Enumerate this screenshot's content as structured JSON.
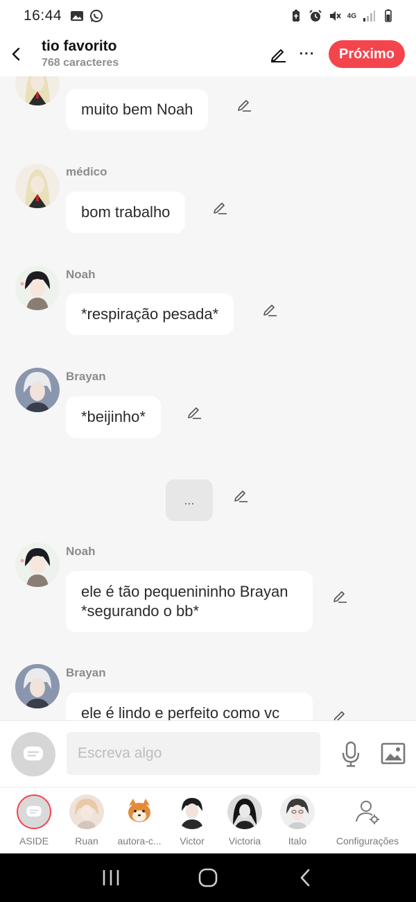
{
  "status_bar": {
    "time": "16:44",
    "network": "4G"
  },
  "header": {
    "title": "tio favorito",
    "subtitle": "768 caracteres",
    "next_label": "Próximo",
    "more_label": "···"
  },
  "messages": [
    {
      "sender": "",
      "text": "muito bem Noah",
      "avatar": "medico-avatar"
    },
    {
      "sender": "médico",
      "text": "bom trabalho",
      "avatar": "medico-avatar"
    },
    {
      "sender": "Noah",
      "text": "*respiração pesada*",
      "avatar": "noah-avatar"
    },
    {
      "sender": "Brayan",
      "text": "*beijinho*",
      "avatar": "brayan-avatar"
    },
    {
      "typing": "..."
    },
    {
      "sender": "Noah",
      "text": "ele é tão pequenininho Brayan *segurando o bb*",
      "avatar": "noah-avatar"
    },
    {
      "sender": "Brayan",
      "text": "ele é lindo e perfeito como vc",
      "avatar": "brayan-avatar"
    }
  ],
  "input": {
    "placeholder": "Escreva algo"
  },
  "characters": [
    {
      "label": "ASIDE",
      "icon": "aside-icon"
    },
    {
      "label": "Ruan",
      "icon": "ruan-avatar"
    },
    {
      "label": "autora-c...",
      "icon": "shiba-avatar"
    },
    {
      "label": "Victor",
      "icon": "victor-avatar"
    },
    {
      "label": "Victoria",
      "icon": "victoria-avatar"
    },
    {
      "label": "Italo",
      "icon": "italo-avatar"
    },
    {
      "label": "Configurações",
      "icon": "settings-user-icon"
    }
  ],
  "colors": {
    "accent": "#f4454d",
    "background": "#f6f6f6",
    "bubble": "#ffffff"
  }
}
